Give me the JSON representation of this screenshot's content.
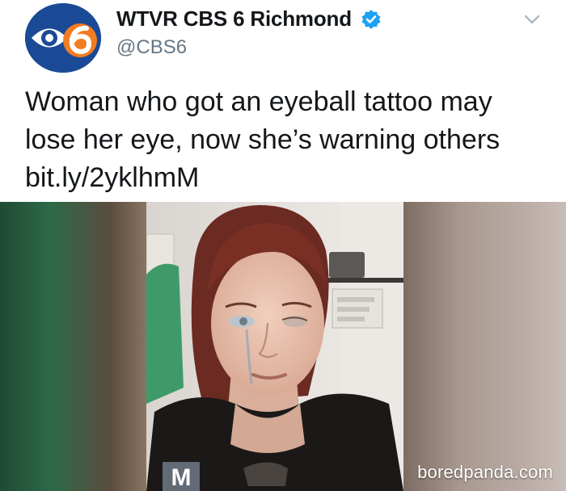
{
  "tweet": {
    "display_name": "WTVR CBS 6 Richmond",
    "handle": "@CBS6",
    "text_line1": "Woman who got an eyeball tattoo may",
    "text_line2": "lose her eye, now she’s warning others",
    "link": "bit.ly/2yklhmM",
    "avatar_icon": "cbs-6-logo-icon",
    "verified_icon": "verified-badge-icon",
    "menu_icon": "chevron-down-icon",
    "avatar_color": "#1a4a96",
    "verified_color": "#1da1f2"
  },
  "photo": {
    "watermark": "boredpanda.com",
    "badge_letter": "M"
  }
}
